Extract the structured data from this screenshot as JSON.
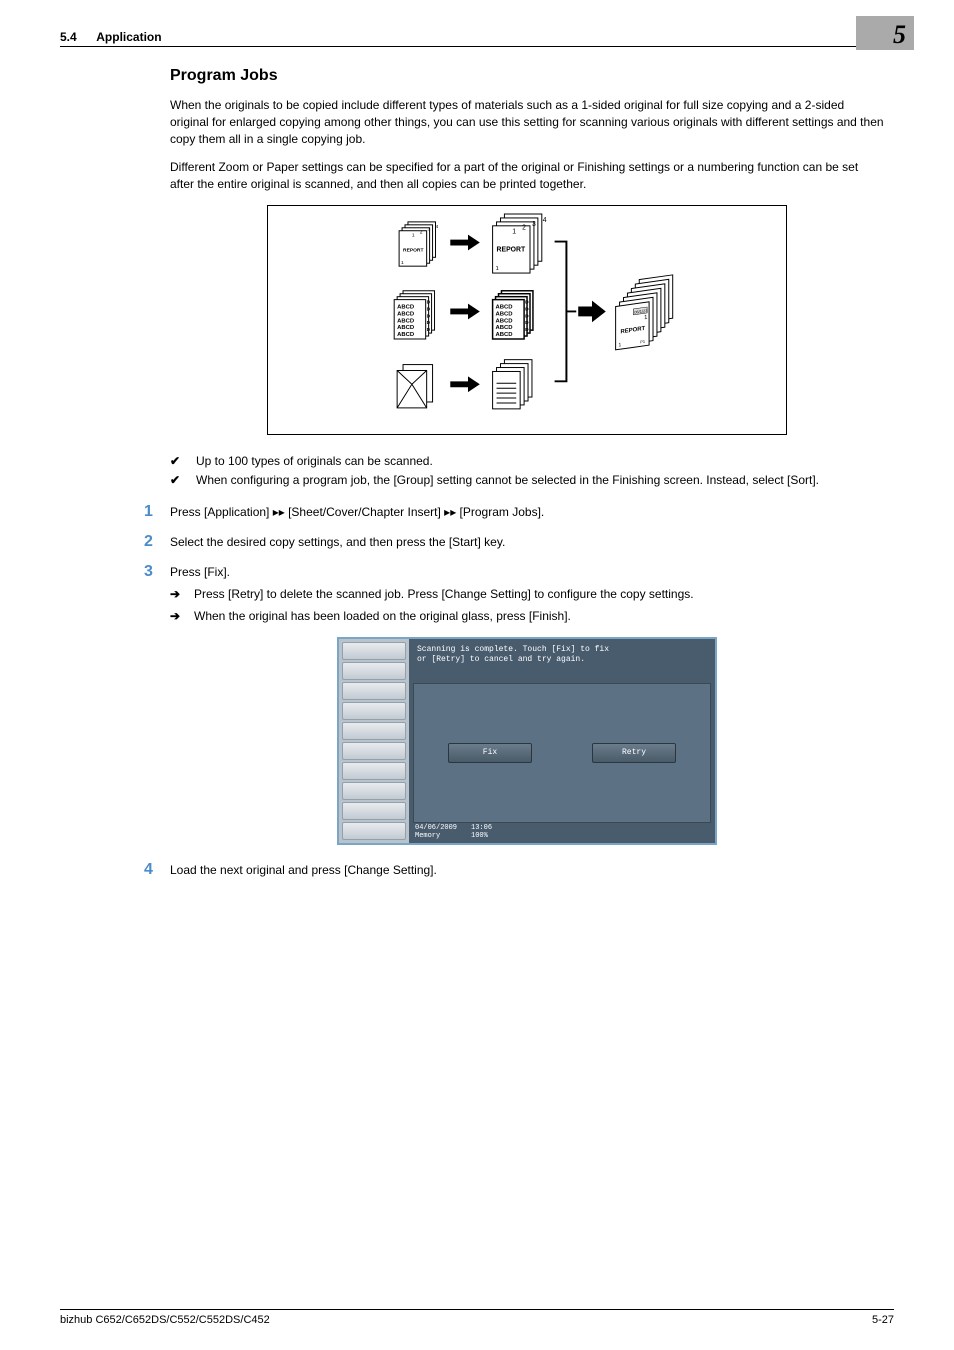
{
  "header": {
    "section_num": "5.4",
    "section_label": "Application",
    "chapter_num": "5"
  },
  "title": "Program Jobs",
  "paragraphs": {
    "p1": "When the originals to be copied include different types of materials such as a 1-sided original for full size copying and a 2-sided original for enlarged copying among other things, you can use this setting for scanning various originals with different settings and then copy them all in a single copying job.",
    "p2": "Different Zoom or Paper settings can be specified for a part of the original or Finishing settings or a numbering function can be set after the entire original is scanned, and then all copies can be printed together."
  },
  "bullets": {
    "b1": "Up to 100 types of originals can be scanned.",
    "b2": "When configuring a program job, the [Group] setting cannot be selected in the Finishing screen. Instead, select [Sort]."
  },
  "steps": {
    "s1": "Press [Application] ▸▸ [Sheet/Cover/Chapter Insert] ▸▸ [Program Jobs].",
    "s2": "Select the desired copy settings, and then press the [Start] key.",
    "s3": "Press [Fix].",
    "s3_sub1": "Press [Retry] to delete the scanned job. Press [Change Setting] to configure the copy settings.",
    "s3_sub2": "When the original has been loaded on the original glass, press [Finish].",
    "s4": "Load the next original and press [Change Setting]."
  },
  "step_nums": {
    "n1": "1",
    "n2": "2",
    "n3": "3",
    "n4": "4"
  },
  "screenshot": {
    "message_l1": "Scanning is complete. Touch [Fix] to fix",
    "message_l2": "or [Retry] to cancel and try again.",
    "fix_btn": "Fix",
    "retry_btn": "Retry",
    "date": "04/06/2009",
    "time": "13:06",
    "mem_label": "Memory",
    "mem_pct": "100%"
  },
  "diagram": {
    "report": "REPORT",
    "abcd": "ABCD",
    "d": "D",
    "date_small": "06/1/23",
    "one": "1",
    "two": "2",
    "three": "3",
    "four": "4",
    "p1": "P1"
  },
  "footer": {
    "model": "bizhub C652/C652DS/C552/C552DS/C452",
    "page": "5-27"
  }
}
